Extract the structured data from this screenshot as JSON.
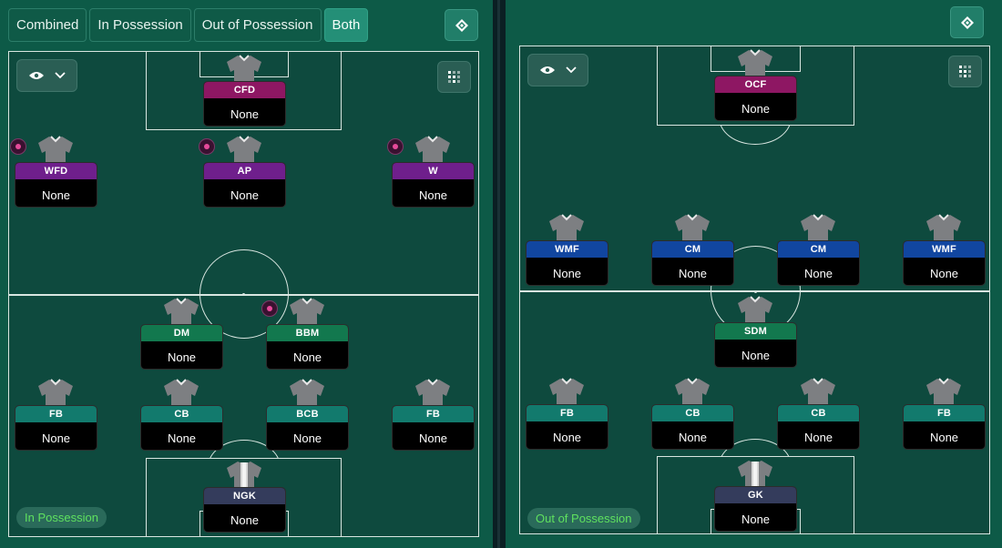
{
  "tabs": [
    {
      "label": "Combined",
      "active": false
    },
    {
      "label": "In Possession",
      "active": false
    },
    {
      "label": "Out of Possession",
      "active": false
    },
    {
      "label": "Both",
      "active": true
    }
  ],
  "colors": {
    "striker": "#8e1763",
    "attacker": "#6f1f8c",
    "midfield_out": "#1146a0",
    "defensive_mid": "#12784e",
    "defender": "#127a6d",
    "keeper": "#343c5c"
  },
  "in_possession": {
    "label": "In Possession",
    "players": [
      {
        "role": "CFD",
        "name": "None",
        "group": "striker"
      },
      {
        "role": "WFD",
        "name": "None",
        "group": "attacker"
      },
      {
        "role": "AP",
        "name": "None",
        "group": "attacker"
      },
      {
        "role": "W",
        "name": "None",
        "group": "attacker"
      },
      {
        "role": "DM",
        "name": "None",
        "group": "defensive_mid"
      },
      {
        "role": "BBM",
        "name": "None",
        "group": "defensive_mid"
      },
      {
        "role": "FB",
        "name": "None",
        "group": "defender"
      },
      {
        "role": "CB",
        "name": "None",
        "group": "defender"
      },
      {
        "role": "BCB",
        "name": "None",
        "group": "defender"
      },
      {
        "role": "FB",
        "name": "None",
        "group": "defender"
      },
      {
        "role": "NGK",
        "name": "None",
        "group": "keeper"
      }
    ]
  },
  "out_of_possession": {
    "label": "Out of Possession",
    "players": [
      {
        "role": "OCF",
        "name": "None",
        "group": "striker"
      },
      {
        "role": "WMF",
        "name": "None",
        "group": "midfield_out"
      },
      {
        "role": "CM",
        "name": "None",
        "group": "midfield_out"
      },
      {
        "role": "CM",
        "name": "None",
        "group": "midfield_out"
      },
      {
        "role": "WMF",
        "name": "None",
        "group": "midfield_out"
      },
      {
        "role": "SDM",
        "name": "None",
        "group": "defensive_mid"
      },
      {
        "role": "FB",
        "name": "None",
        "group": "defender"
      },
      {
        "role": "CB",
        "name": "None",
        "group": "defender"
      },
      {
        "role": "CB",
        "name": "None",
        "group": "defender"
      },
      {
        "role": "FB",
        "name": "None",
        "group": "defender"
      },
      {
        "role": "GK",
        "name": "None",
        "group": "keeper"
      }
    ]
  }
}
